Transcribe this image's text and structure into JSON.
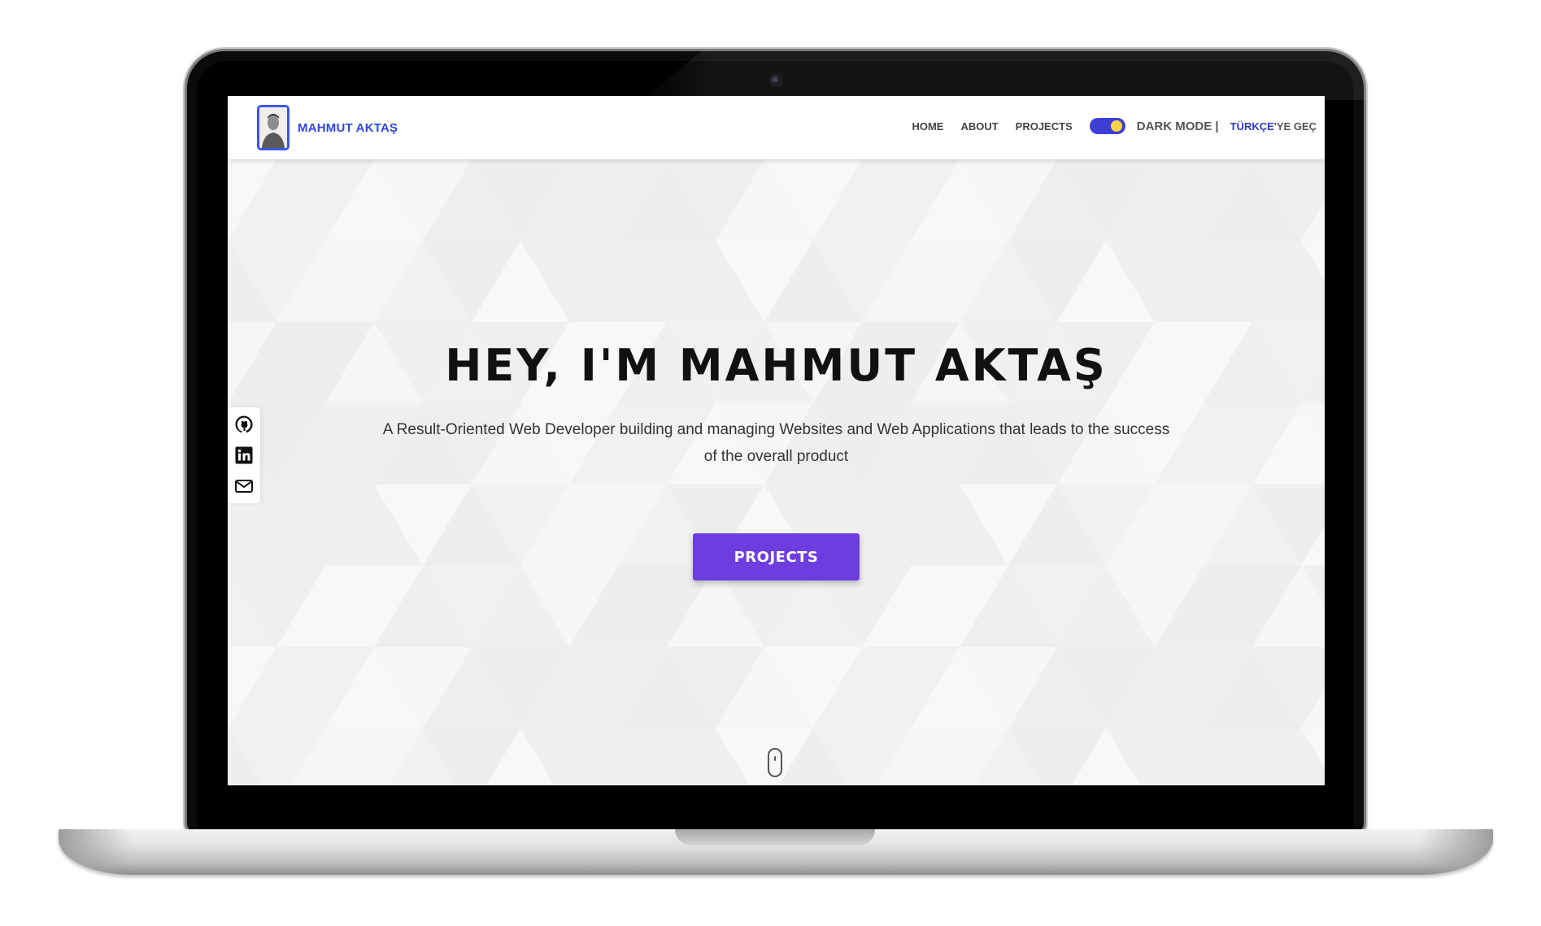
{
  "brand": {
    "name": "MAHMUT AKTAŞ",
    "accent_color": "#2e48dd"
  },
  "nav": {
    "links": [
      "HOME",
      "ABOUT",
      "PROJECTS"
    ],
    "dark_mode_label": "DARK MODE |",
    "dark_mode_on": true,
    "lang_highlight": "TÜRKÇE",
    "lang_rest": "'YE GEÇ"
  },
  "social": {
    "icons": [
      "github-icon",
      "linkedin-icon",
      "email-icon"
    ]
  },
  "hero": {
    "title": "HEY, I'M MAHMUT AKTAŞ",
    "subtitle": "A Result-Oriented Web Developer building and managing Websites and Web Applications that leads to the success of the overall product",
    "cta_label": "PROJECTS",
    "cta_color": "#6d3de0"
  }
}
